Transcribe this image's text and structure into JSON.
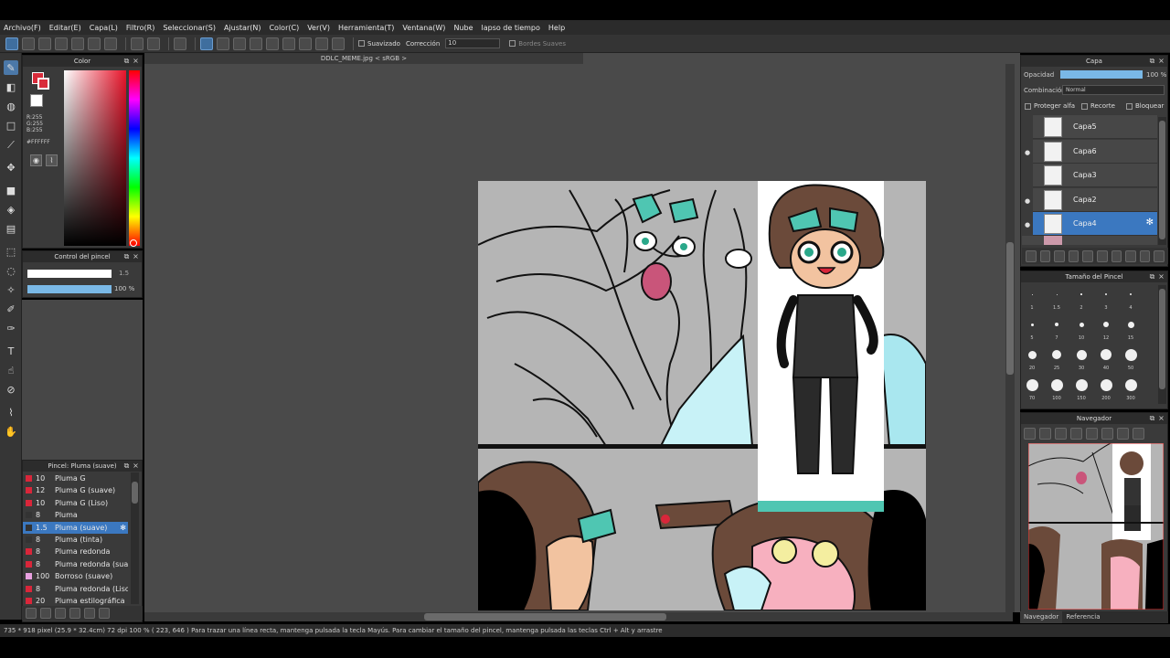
{
  "menu": [
    "Archivo(F)",
    "Editar(E)",
    "Capa(L)",
    "Filtro(R)",
    "Seleccionar(S)",
    "Ajustar(N)",
    "Color(C)",
    "Ver(V)",
    "Herramienta(T)",
    "Ventana(W)",
    "Nube",
    "lapso de tiempo",
    "Help"
  ],
  "toolbar": {
    "smooth_label": "Suavizado",
    "correction_label": "Corrección",
    "correction_value": "10",
    "soft_edges_label": "Bordes Suaves"
  },
  "document": {
    "tab": "DDLC_MEME.jpg < sRGB >"
  },
  "color_panel": {
    "title": "Color",
    "r": "R:255",
    "g": "G:255",
    "b": "B:255",
    "hex": "#FFFFFF",
    "fg_color": "#d92b3a",
    "bg_color": "#ffffff"
  },
  "brush_control": {
    "title": "Control del pincel",
    "size": "1.5",
    "opacity": "100 %",
    "opacity_fraction": 1.0
  },
  "brush_panel": {
    "title": "Pincel: Pluma (suave)",
    "items": [
      {
        "size": "10",
        "name": "Pluma G",
        "color": "#d9263a"
      },
      {
        "size": "12",
        "name": "Pluma G (suave)",
        "color": "#d9263a"
      },
      {
        "size": "10",
        "name": "Pluma G (Liso)",
        "color": "#d9263a"
      },
      {
        "size": "8",
        "name": "Pluma",
        "color": "#333333"
      },
      {
        "size": "1.5",
        "name": "Pluma (suave)",
        "color": "#333333",
        "selected": true
      },
      {
        "size": "8",
        "name": "Pluma (tinta)",
        "color": "#333333"
      },
      {
        "size": "8",
        "name": "Pluma redonda",
        "color": "#d9263a"
      },
      {
        "size": "8",
        "name": "Pluma redonda (suave",
        "color": "#d9263a"
      },
      {
        "size": "100",
        "name": "Borroso (suave)",
        "color": "#e8a0e0"
      },
      {
        "size": "8",
        "name": "Pluma redonda (Liso)",
        "color": "#d9263a"
      },
      {
        "size": "20",
        "name": "Pluma estilográfica",
        "color": "#d9263a"
      }
    ]
  },
  "layer_panel": {
    "title": "Capa",
    "opacity_label": "Opacidad",
    "opacity_value": "100 %",
    "blend_label": "Combinación",
    "blend_value": "Normal",
    "protect_alpha": "Proteger alfa",
    "clip": "Recorte",
    "lock": "Bloquear",
    "layers": [
      {
        "name": "Capa5",
        "visible": false,
        "selected": false
      },
      {
        "name": "Capa6",
        "visible": true,
        "selected": false
      },
      {
        "name": "Capa3",
        "visible": false,
        "selected": false
      },
      {
        "name": "Capa2",
        "visible": true,
        "selected": false
      },
      {
        "name": "Capa4",
        "visible": true,
        "selected": true
      }
    ]
  },
  "brush_size_panel": {
    "title": "Tamaño del Pincel",
    "sizes": [
      "1",
      "1.5",
      "2",
      "3",
      "4",
      "5",
      "7",
      "10",
      "12",
      "15",
      "20",
      "25",
      "30",
      "40",
      "50",
      "70",
      "100",
      "150",
      "200",
      "300"
    ]
  },
  "navigator": {
    "title": "Navegador",
    "tab_nav": "Navegador",
    "tab_ref": "Referencia"
  },
  "status": {
    "text": "735 * 918 pixel  (25.9 * 32.4cm)  72 dpi  100 %  ( 223, 646 )  Para trazar una línea recta, mantenga pulsada la tecla Mayús. Para cambiar el tamaño del pincel, mantenga pulsada las teclas Ctrl + Alt y arrastre"
  }
}
